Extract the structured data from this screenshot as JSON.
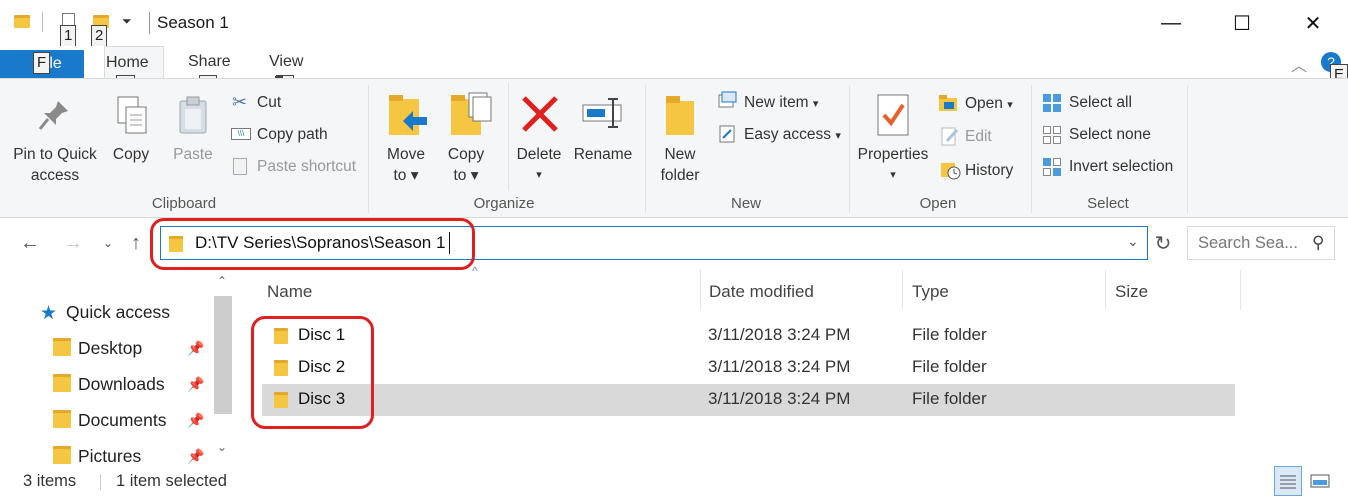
{
  "window": {
    "title": "Season 1",
    "minimize_glyph": "—",
    "maximize_glyph": "☐",
    "close_glyph": "✕"
  },
  "keytips": {
    "qat1": "1",
    "qat2": "2",
    "file": "F",
    "home": "H",
    "share": "S",
    "view": "V",
    "expand": "E"
  },
  "tabs": {
    "file": "File",
    "home": "Home",
    "share": "Share",
    "view": "View"
  },
  "ribbon": {
    "clipboard": {
      "group_label": "Clipboard",
      "pin_line1": "Pin to Quick",
      "pin_line2": "access",
      "copy": "Copy",
      "paste": "Paste",
      "cut": "Cut",
      "copy_path": "Copy path",
      "paste_shortcut": "Paste shortcut"
    },
    "organize": {
      "group_label": "Organize",
      "move_line1": "Move",
      "move_line2": "to",
      "copy_line1": "Copy",
      "copy_line2": "to",
      "delete": "Delete",
      "rename": "Rename"
    },
    "new": {
      "group_label": "New",
      "new_folder_line1": "New",
      "new_folder_line2": "folder",
      "new_item": "New item",
      "easy_access": "Easy access"
    },
    "open": {
      "group_label": "Open",
      "properties": "Properties",
      "open": "Open",
      "edit": "Edit",
      "history": "History"
    },
    "select": {
      "group_label": "Select",
      "select_all": "Select all",
      "select_none": "Select none",
      "invert_selection": "Invert selection"
    }
  },
  "address": {
    "path": "D:\\TV Series\\Sopranos\\Season 1",
    "search_placeholder": "Search Sea..."
  },
  "navpane": {
    "quick_access": "Quick access",
    "items": [
      {
        "label": "Desktop"
      },
      {
        "label": "Downloads"
      },
      {
        "label": "Documents"
      },
      {
        "label": "Pictures"
      }
    ]
  },
  "filelist": {
    "columns": [
      "Name",
      "Date modified",
      "Type",
      "Size"
    ],
    "rows": [
      {
        "name": "Disc 1",
        "date": "3/11/2018 3:24 PM",
        "type": "File folder",
        "size": "",
        "selected": false
      },
      {
        "name": "Disc 2",
        "date": "3/11/2018 3:24 PM",
        "type": "File folder",
        "size": "",
        "selected": false
      },
      {
        "name": "Disc 3",
        "date": "3/11/2018 3:24 PM",
        "type": "File folder",
        "size": "",
        "selected": true
      }
    ]
  },
  "status": {
    "items_count": "3 items",
    "selection": "1 item selected"
  },
  "colors": {
    "accent": "#1979ca",
    "annotation": "#e0201f",
    "folder": "#f5c641",
    "selected_row": "#d9d9d9"
  }
}
